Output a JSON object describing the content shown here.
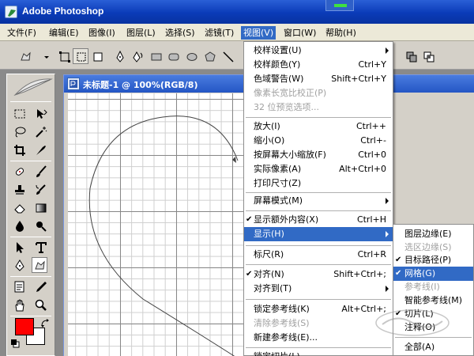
{
  "window": {
    "title": "Adobe Photoshop"
  },
  "menubar": {
    "items": [
      "文件(F)",
      "编辑(E)",
      "图像(I)",
      "图层(L)",
      "选择(S)",
      "滤镜(T)",
      "视图(V)",
      "窗口(W)",
      "帮助(H)"
    ],
    "active_index": 6
  },
  "document": {
    "title": "未标题-1 @ 100%(RGB/8)"
  },
  "view_menu": {
    "items": [
      {
        "label": "校样设置(U)",
        "shortcut": "",
        "submenu": true,
        "checked": false,
        "disabled": false,
        "highlighted": false
      },
      {
        "label": "校样颜色(Y)",
        "shortcut": "Ctrl+Y",
        "submenu": false,
        "checked": false,
        "disabled": false,
        "highlighted": false
      },
      {
        "label": "色域警告(W)",
        "shortcut": "Shift+Ctrl+Y",
        "submenu": false,
        "checked": false,
        "disabled": false,
        "highlighted": false
      },
      {
        "label": "像素长宽比校正(P)",
        "shortcut": "",
        "submenu": false,
        "checked": false,
        "disabled": true,
        "highlighted": false
      },
      {
        "label": "32 位预览选项...",
        "shortcut": "",
        "submenu": false,
        "checked": false,
        "disabled": true,
        "highlighted": false
      },
      {
        "label": "放大(I)",
        "shortcut": "Ctrl++",
        "submenu": false,
        "checked": false,
        "disabled": false,
        "highlighted": false
      },
      {
        "label": "缩小(O)",
        "shortcut": "Ctrl+-",
        "submenu": false,
        "checked": false,
        "disabled": false,
        "highlighted": false
      },
      {
        "label": "按屏幕大小缩放(F)",
        "shortcut": "Ctrl+0",
        "submenu": false,
        "checked": false,
        "disabled": false,
        "highlighted": false
      },
      {
        "label": "实际像素(A)",
        "shortcut": "Alt+Ctrl+0",
        "submenu": false,
        "checked": false,
        "disabled": false,
        "highlighted": false
      },
      {
        "label": "打印尺寸(Z)",
        "shortcut": "",
        "submenu": false,
        "checked": false,
        "disabled": false,
        "highlighted": false
      },
      {
        "label": "屏幕模式(M)",
        "shortcut": "",
        "submenu": true,
        "checked": false,
        "disabled": false,
        "highlighted": false
      },
      {
        "label": "显示额外内容(X)",
        "shortcut": "Ctrl+H",
        "submenu": false,
        "checked": true,
        "disabled": false,
        "highlighted": false
      },
      {
        "label": "显示(H)",
        "shortcut": "",
        "submenu": true,
        "checked": false,
        "disabled": false,
        "highlighted": true
      },
      {
        "label": "标尺(R)",
        "shortcut": "Ctrl+R",
        "submenu": false,
        "checked": false,
        "disabled": false,
        "highlighted": false
      },
      {
        "label": "对齐(N)",
        "shortcut": "Shift+Ctrl+;",
        "submenu": false,
        "checked": true,
        "disabled": false,
        "highlighted": false
      },
      {
        "label": "对齐到(T)",
        "shortcut": "",
        "submenu": true,
        "checked": false,
        "disabled": false,
        "highlighted": false
      },
      {
        "label": "锁定参考线(K)",
        "shortcut": "Alt+Ctrl+;",
        "submenu": false,
        "checked": false,
        "disabled": false,
        "highlighted": false
      },
      {
        "label": "清除参考线(S)",
        "shortcut": "",
        "submenu": false,
        "checked": false,
        "disabled": true,
        "highlighted": false
      },
      {
        "label": "新建参考线(E)...",
        "shortcut": "",
        "submenu": false,
        "checked": false,
        "disabled": false,
        "highlighted": false
      },
      {
        "label": "锁定切片(L)",
        "shortcut": "",
        "submenu": false,
        "checked": false,
        "disabled": false,
        "highlighted": false
      }
    ]
  },
  "show_submenu": {
    "items": [
      {
        "label": "图层边缘(E)",
        "checked": false,
        "disabled": false,
        "highlighted": false
      },
      {
        "label": "选区边缘(S)",
        "checked": false,
        "disabled": true,
        "highlighted": false
      },
      {
        "label": "目标路径(P)",
        "checked": true,
        "disabled": false,
        "highlighted": false
      },
      {
        "label": "网格(G)",
        "checked": true,
        "disabled": false,
        "highlighted": true
      },
      {
        "label": "参考线(I)",
        "checked": false,
        "disabled": true,
        "highlighted": false
      },
      {
        "label": "智能参考线(M)",
        "checked": false,
        "disabled": false,
        "highlighted": false
      },
      {
        "label": "切片(L)",
        "checked": true,
        "disabled": false,
        "highlighted": false
      },
      {
        "label": "注释(O)",
        "checked": false,
        "disabled": false,
        "highlighted": false
      },
      {
        "label": "全部(A)",
        "checked": false,
        "disabled": false,
        "highlighted": false
      }
    ]
  },
  "colors": {
    "foreground": "#ff0000",
    "background": "#ffffff",
    "accent": "#316ac5"
  },
  "icons": {
    "options_bar": [
      "custom-shape-icon",
      "shape-layer-icon",
      "path-mode-icon",
      "fill-pixels-icon",
      "pen-icon",
      "freeform-pen-icon",
      "rectangle-icon",
      "rounded-rectangle-icon",
      "ellipse-icon",
      "polygon-icon",
      "line-icon"
    ],
    "toolbox": [
      "marquee-icon",
      "move-icon",
      "lasso-icon",
      "magic-wand-icon",
      "crop-icon",
      "slice-icon",
      "healing-brush-icon",
      "brush-icon",
      "clone-stamp-icon",
      "history-brush-icon",
      "eraser-icon",
      "gradient-icon",
      "blur-icon",
      "dodge-icon",
      "path-selection-icon",
      "type-icon",
      "pen-tool-icon",
      "custom-shape-tool-icon",
      "notes-icon",
      "eyedropper-icon",
      "hand-icon",
      "zoom-icon"
    ]
  }
}
